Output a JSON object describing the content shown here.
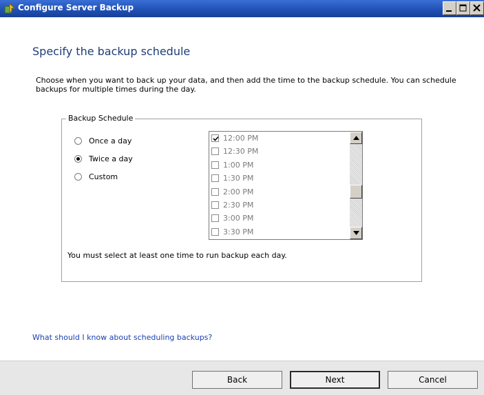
{
  "window": {
    "title": "Configure Server Backup",
    "app_icon": "backup-icon",
    "caption_buttons": [
      "minimize-icon",
      "maximize-icon",
      "close-icon"
    ]
  },
  "page": {
    "heading": "Specify the backup schedule",
    "description": "Choose when you want to back up your data, and then add the time to the backup schedule. You can schedule backups for multiple times during the day."
  },
  "schedule": {
    "group_label": "Backup Schedule",
    "options": [
      {
        "label": "Once a day",
        "selected": false
      },
      {
        "label": "Twice a day",
        "selected": true
      },
      {
        "label": "Custom",
        "selected": false
      }
    ],
    "times": [
      {
        "label": "12:00 PM",
        "checked": true
      },
      {
        "label": "12:30 PM",
        "checked": false
      },
      {
        "label": "1:00 PM",
        "checked": false
      },
      {
        "label": "1:30 PM",
        "checked": false
      },
      {
        "label": "2:00 PM",
        "checked": false
      },
      {
        "label": "2:30 PM",
        "checked": false
      },
      {
        "label": "3:00 PM",
        "checked": false
      },
      {
        "label": "3:30 PM",
        "checked": false
      }
    ],
    "hint": "You must select at least one time to run backup each day."
  },
  "help_link": "What should I know about scheduling backups?",
  "buttons": {
    "back": "Back",
    "next": "Next",
    "cancel": "Cancel"
  },
  "colors": {
    "titlebar": "#1f4fb3",
    "heading": "#1e3d78",
    "link": "#1a3fb0"
  }
}
